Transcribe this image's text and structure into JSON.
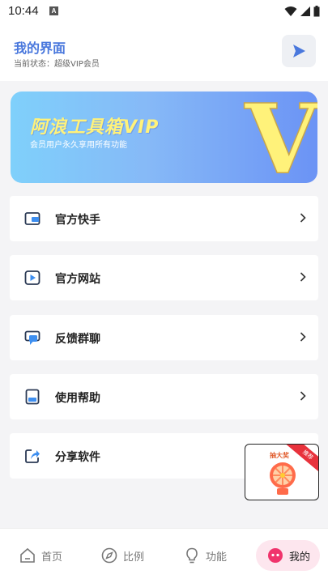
{
  "status": {
    "time": "10:44",
    "notif_letter": "A"
  },
  "header": {
    "title": "我的界面",
    "subtitle": "当前状态：超级VIP会员"
  },
  "banner": {
    "title": "阿浪工具箱VIP",
    "subtitle": "会员用户永久享用所有功能",
    "badge_letter": "V"
  },
  "menu": [
    {
      "label": "官方快手",
      "icon": "wallet-icon"
    },
    {
      "label": "官方网站",
      "icon": "play-icon"
    },
    {
      "label": "反馈群聊",
      "icon": "chat-icon"
    },
    {
      "label": "使用帮助",
      "icon": "book-icon"
    },
    {
      "label": "分享软件",
      "icon": "share-icon"
    }
  ],
  "float_ad": {
    "title": "抽大奖",
    "ribbon": "推荐"
  },
  "nav": [
    {
      "label": "首页",
      "icon": "home-icon"
    },
    {
      "label": "比例",
      "icon": "compass-icon"
    },
    {
      "label": "功能",
      "icon": "bulb-icon"
    },
    {
      "label": "我的",
      "icon": "profile-icon",
      "active": true
    }
  ],
  "colors": {
    "accent": "#4a78dd",
    "active_nav_bg": "#fde6ee",
    "active_nav_icon": "#f0346c",
    "banner_title": "#fff27a"
  }
}
